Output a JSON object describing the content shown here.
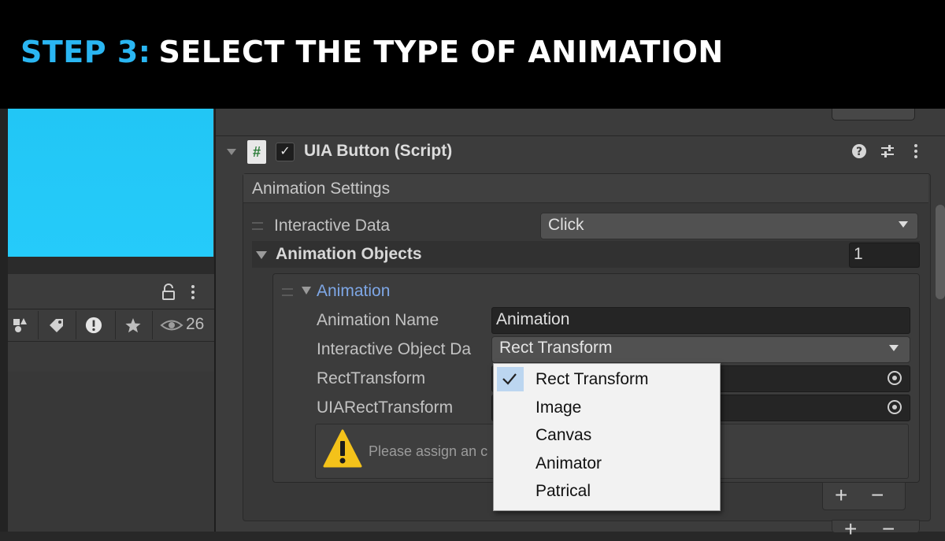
{
  "banner": {
    "step": "STEP 3:",
    "title": "SELECT THE TYPE OF ANIMATION"
  },
  "colors": {
    "banner_step": "#2ab6f2",
    "preview": "#25cbfa",
    "popup_selected": "#bcd6f0",
    "element_label": "#7ea7e6",
    "warning": "#f4c21a"
  },
  "left_panel": {
    "eye_count": "26"
  },
  "component": {
    "title": "UIA Button (Script)",
    "section_title": "Animation Settings",
    "interactive_data": {
      "label": "Interactive Data",
      "value": "Click"
    },
    "animation_objects": {
      "label": "Animation Objects",
      "count": "1"
    },
    "element": {
      "label": "Animation",
      "name": {
        "label": "Animation Name",
        "value": "Animation"
      },
      "object_data": {
        "label": "Interactive Object Da",
        "value": "Rect Transform"
      },
      "rect_transform": {
        "label": "RectTransform"
      },
      "uia_rect_transform": {
        "label": "UIARectTransform"
      },
      "warning": "Please assign an c"
    },
    "add_glyph": "+",
    "remove_glyph": "−"
  },
  "dropdown": {
    "options": [
      "Rect Transform",
      "Image",
      "Canvas",
      "Animator",
      "Patrical"
    ],
    "selected": "Rect Transform"
  }
}
